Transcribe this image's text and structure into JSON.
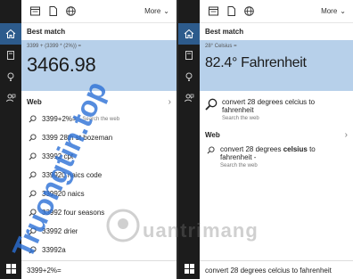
{
  "left": {
    "more_label": "More",
    "best_title": "Best match",
    "calc_expr": "3399 + (3399 * (2%)) =",
    "calc_result": "3466.98",
    "web_title": "Web",
    "web_first": "3399+2%=",
    "web_first_hint": "- Search the web",
    "suggestions": [
      "3399 28th st bozeman",
      "33992 cpt",
      "339920 naics code",
      "339920 naics",
      "33992 four seasons",
      "33992 drier",
      "33992a"
    ],
    "search_value": "3399+2%="
  },
  "right": {
    "more_label": "More",
    "best_title": "Best match",
    "conv_expr": "28° Celsius =",
    "conv_result": "82.4° Fahrenheit",
    "top_sugg": "convert 28 degrees celcius to fahrenheit",
    "top_sugg_hint": "Search the web",
    "web_title": "Web",
    "web_sugg_pre": "convert 28 degrees ",
    "web_sugg_bold": "celsius",
    "web_sugg_post": " to fahrenheit -",
    "web_sugg_hint": "Search the web",
    "search_value": "convert 28 degrees celcius to fahrenheit"
  },
  "watermark": {
    "vertical": "Truongtin.top",
    "brand": "uantrimang"
  },
  "icons": [
    "home-icon",
    "notebook-icon",
    "feedback-icon",
    "documents-icon",
    "web-icon",
    "search-icon",
    "windows-icon"
  ],
  "colors": {
    "accent": "#2d5b8c",
    "best_match_bg": "#b7d0ea",
    "rail_bg": "#1c1c1c",
    "watermark": "#2a6fd6"
  }
}
